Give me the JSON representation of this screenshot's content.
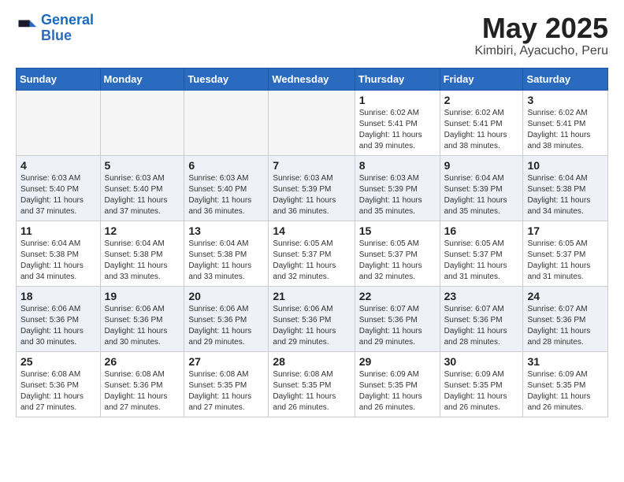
{
  "header": {
    "logo_line1": "General",
    "logo_line2": "Blue",
    "month": "May 2025",
    "location": "Kimbiri, Ayacucho, Peru"
  },
  "weekdays": [
    "Sunday",
    "Monday",
    "Tuesday",
    "Wednesday",
    "Thursday",
    "Friday",
    "Saturday"
  ],
  "weeks": [
    [
      {
        "day": "",
        "info": ""
      },
      {
        "day": "",
        "info": ""
      },
      {
        "day": "",
        "info": ""
      },
      {
        "day": "",
        "info": ""
      },
      {
        "day": "1",
        "info": "Sunrise: 6:02 AM\nSunset: 5:41 PM\nDaylight: 11 hours\nand 39 minutes."
      },
      {
        "day": "2",
        "info": "Sunrise: 6:02 AM\nSunset: 5:41 PM\nDaylight: 11 hours\nand 38 minutes."
      },
      {
        "day": "3",
        "info": "Sunrise: 6:02 AM\nSunset: 5:41 PM\nDaylight: 11 hours\nand 38 minutes."
      }
    ],
    [
      {
        "day": "4",
        "info": "Sunrise: 6:03 AM\nSunset: 5:40 PM\nDaylight: 11 hours\nand 37 minutes."
      },
      {
        "day": "5",
        "info": "Sunrise: 6:03 AM\nSunset: 5:40 PM\nDaylight: 11 hours\nand 37 minutes."
      },
      {
        "day": "6",
        "info": "Sunrise: 6:03 AM\nSunset: 5:40 PM\nDaylight: 11 hours\nand 36 minutes."
      },
      {
        "day": "7",
        "info": "Sunrise: 6:03 AM\nSunset: 5:39 PM\nDaylight: 11 hours\nand 36 minutes."
      },
      {
        "day": "8",
        "info": "Sunrise: 6:03 AM\nSunset: 5:39 PM\nDaylight: 11 hours\nand 35 minutes."
      },
      {
        "day": "9",
        "info": "Sunrise: 6:04 AM\nSunset: 5:39 PM\nDaylight: 11 hours\nand 35 minutes."
      },
      {
        "day": "10",
        "info": "Sunrise: 6:04 AM\nSunset: 5:38 PM\nDaylight: 11 hours\nand 34 minutes."
      }
    ],
    [
      {
        "day": "11",
        "info": "Sunrise: 6:04 AM\nSunset: 5:38 PM\nDaylight: 11 hours\nand 34 minutes."
      },
      {
        "day": "12",
        "info": "Sunrise: 6:04 AM\nSunset: 5:38 PM\nDaylight: 11 hours\nand 33 minutes."
      },
      {
        "day": "13",
        "info": "Sunrise: 6:04 AM\nSunset: 5:38 PM\nDaylight: 11 hours\nand 33 minutes."
      },
      {
        "day": "14",
        "info": "Sunrise: 6:05 AM\nSunset: 5:37 PM\nDaylight: 11 hours\nand 32 minutes."
      },
      {
        "day": "15",
        "info": "Sunrise: 6:05 AM\nSunset: 5:37 PM\nDaylight: 11 hours\nand 32 minutes."
      },
      {
        "day": "16",
        "info": "Sunrise: 6:05 AM\nSunset: 5:37 PM\nDaylight: 11 hours\nand 31 minutes."
      },
      {
        "day": "17",
        "info": "Sunrise: 6:05 AM\nSunset: 5:37 PM\nDaylight: 11 hours\nand 31 minutes."
      }
    ],
    [
      {
        "day": "18",
        "info": "Sunrise: 6:06 AM\nSunset: 5:36 PM\nDaylight: 11 hours\nand 30 minutes."
      },
      {
        "day": "19",
        "info": "Sunrise: 6:06 AM\nSunset: 5:36 PM\nDaylight: 11 hours\nand 30 minutes."
      },
      {
        "day": "20",
        "info": "Sunrise: 6:06 AM\nSunset: 5:36 PM\nDaylight: 11 hours\nand 29 minutes."
      },
      {
        "day": "21",
        "info": "Sunrise: 6:06 AM\nSunset: 5:36 PM\nDaylight: 11 hours\nand 29 minutes."
      },
      {
        "day": "22",
        "info": "Sunrise: 6:07 AM\nSunset: 5:36 PM\nDaylight: 11 hours\nand 29 minutes."
      },
      {
        "day": "23",
        "info": "Sunrise: 6:07 AM\nSunset: 5:36 PM\nDaylight: 11 hours\nand 28 minutes."
      },
      {
        "day": "24",
        "info": "Sunrise: 6:07 AM\nSunset: 5:36 PM\nDaylight: 11 hours\nand 28 minutes."
      }
    ],
    [
      {
        "day": "25",
        "info": "Sunrise: 6:08 AM\nSunset: 5:36 PM\nDaylight: 11 hours\nand 27 minutes."
      },
      {
        "day": "26",
        "info": "Sunrise: 6:08 AM\nSunset: 5:36 PM\nDaylight: 11 hours\nand 27 minutes."
      },
      {
        "day": "27",
        "info": "Sunrise: 6:08 AM\nSunset: 5:35 PM\nDaylight: 11 hours\nand 27 minutes."
      },
      {
        "day": "28",
        "info": "Sunrise: 6:08 AM\nSunset: 5:35 PM\nDaylight: 11 hours\nand 26 minutes."
      },
      {
        "day": "29",
        "info": "Sunrise: 6:09 AM\nSunset: 5:35 PM\nDaylight: 11 hours\nand 26 minutes."
      },
      {
        "day": "30",
        "info": "Sunrise: 6:09 AM\nSunset: 5:35 PM\nDaylight: 11 hours\nand 26 minutes."
      },
      {
        "day": "31",
        "info": "Sunrise: 6:09 AM\nSunset: 5:35 PM\nDaylight: 11 hours\nand 26 minutes."
      }
    ]
  ]
}
